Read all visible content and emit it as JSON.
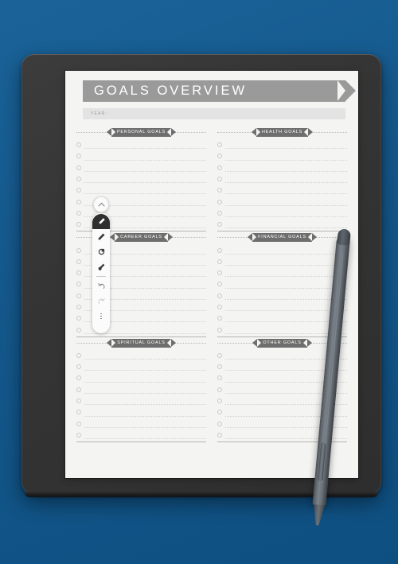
{
  "scene": {
    "background_color": "#15598d",
    "device_color": "#353535",
    "accent_color": "#6e6e6e"
  },
  "document": {
    "title": "GOALS OVERVIEW",
    "year_label": "YEAR:",
    "year_value": "",
    "sections": [
      {
        "name": "personal-goals",
        "label": "PERSONAL GOALS",
        "rows": 8
      },
      {
        "name": "health-goals",
        "label": "HEALTH GOALS",
        "rows": 8
      },
      {
        "name": "career-goals",
        "label": "CAREER GOALS",
        "rows": 8
      },
      {
        "name": "financial-goals",
        "label": "FINANCIAL GOALS",
        "rows": 8
      },
      {
        "name": "spiritual-goals",
        "label": "SPIRITUAL GOALS",
        "rows": 8
      },
      {
        "name": "other-goals",
        "label": "OTHER GOALS",
        "rows": 8
      }
    ]
  },
  "toolbar": {
    "collapse_icon": "chevron-up-icon",
    "tools": [
      {
        "name": "pen-tool",
        "icon": "pen-icon",
        "active": true
      },
      {
        "name": "marker-tool",
        "icon": "marker-icon",
        "active": false
      },
      {
        "name": "pencil-tool",
        "icon": "pencil-icon",
        "active": false
      },
      {
        "name": "eraser-tool",
        "icon": "eraser-icon",
        "active": false
      },
      {
        "name": "undo-button",
        "icon": "undo-icon",
        "active": false
      },
      {
        "name": "redo-button",
        "icon": "redo-icon",
        "active": false
      },
      {
        "name": "more-options",
        "icon": "more-vertical-icon",
        "active": false
      }
    ]
  },
  "stylus": {
    "name": "stylus-pen",
    "color": "#5e666e"
  }
}
